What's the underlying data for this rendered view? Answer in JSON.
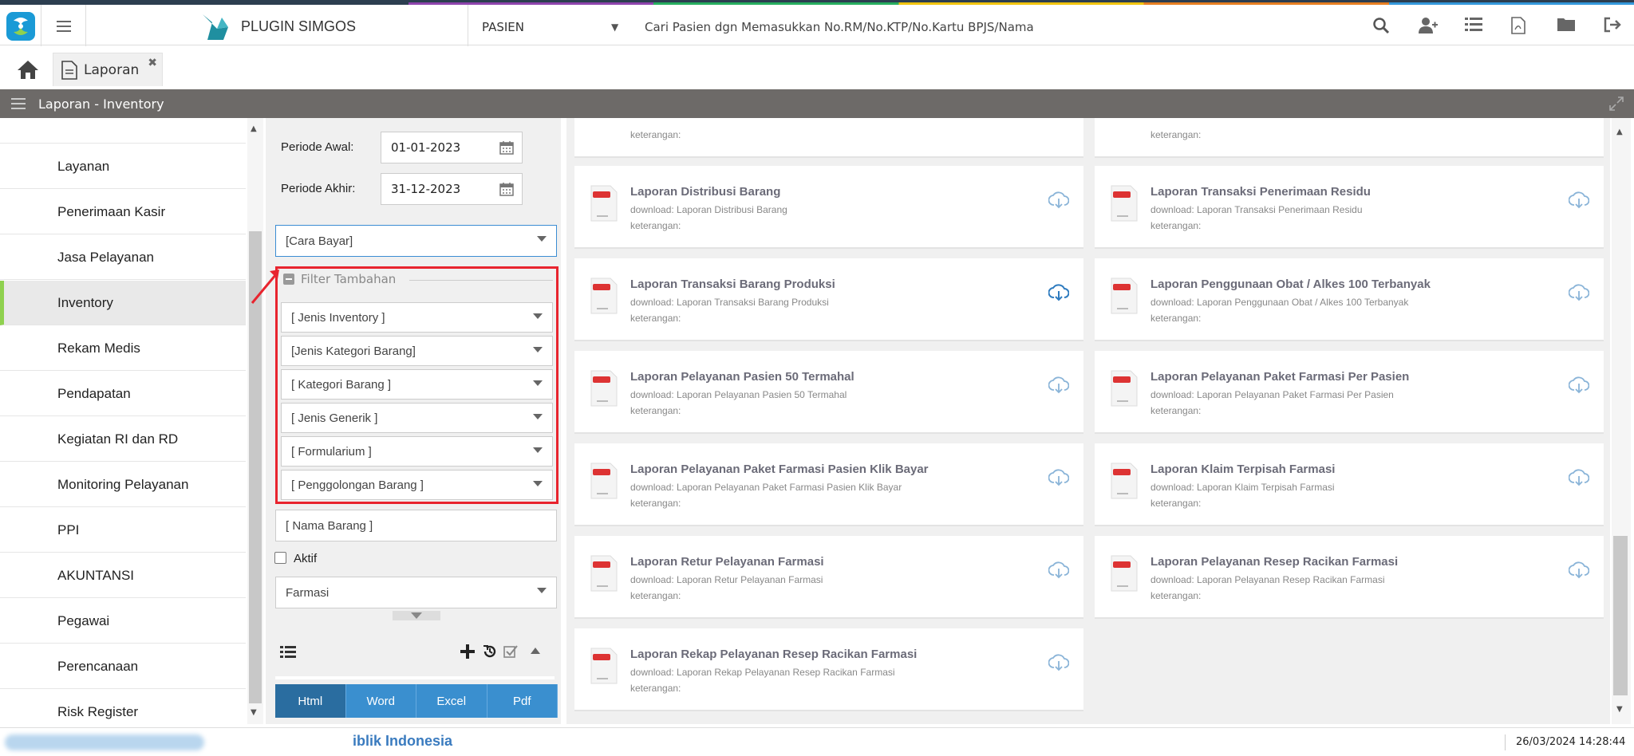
{
  "topbar": {
    "app_name": "PLUGIN SIMGOS",
    "patient_select": "PASIEN",
    "search_placeholder": "Cari Pasien dgn Memasukkan No.RM/No.KTP/No.Kartu BPJS/Nama",
    "icons": [
      "search-icon",
      "add-user-icon",
      "list-icon",
      "pdf-file-icon",
      "folder-icon",
      "logout-icon"
    ]
  },
  "tabs": [
    {
      "label": "Laporan"
    }
  ],
  "section": {
    "title": "Laporan - Inventory"
  },
  "sidebar": {
    "items": [
      {
        "label": "Layanan"
      },
      {
        "label": "Penerimaan Kasir"
      },
      {
        "label": "Jasa Pelayanan"
      },
      {
        "label": "Inventory",
        "active": true
      },
      {
        "label": "Rekam Medis"
      },
      {
        "label": "Pendapatan"
      },
      {
        "label": "Kegiatan RI dan RD"
      },
      {
        "label": "Monitoring Pelayanan"
      },
      {
        "label": "PPI"
      },
      {
        "label": "AKUNTANSI"
      },
      {
        "label": "Pegawai"
      },
      {
        "label": "Perencanaan"
      },
      {
        "label": "Risk Register"
      }
    ]
  },
  "filters": {
    "periode_awal_label": "Periode Awal:",
    "periode_awal_value": "01-01-2023",
    "periode_akhir_label": "Periode Akhir:",
    "periode_akhir_value": "31-12-2023",
    "cara_bayar": "[Cara Bayar]",
    "filter_tambahan": "Filter Tambahan",
    "extra": [
      "[ Jenis Inventory ]",
      "[Jenis Kategori Barang]",
      "[ Kategori Barang ]",
      "[ Jenis Generik ]",
      "[ Formularium ]",
      "[ Penggolongan Barang ]"
    ],
    "nama_barang": "[ Nama Barang ]",
    "aktif_label": "Aktif",
    "unit": "Farmasi"
  },
  "export_tabs": [
    "Html",
    "Word",
    "Excel",
    "Pdf"
  ],
  "reports": {
    "keterangan": "keterangan:",
    "items": [
      {
        "title": "Laporan Distribusi Barang",
        "download": "download: Laporan Distribusi Barang"
      },
      {
        "title": "Laporan Transaksi Penerimaan Residu",
        "download": "download: Laporan Transaksi Penerimaan Residu"
      },
      {
        "title": "Laporan Transaksi Barang Produksi",
        "download": "download: Laporan Transaksi Barang Produksi"
      },
      {
        "title": "Laporan Penggunaan Obat / Alkes 100 Terbanyak",
        "download": "download: Laporan Penggunaan Obat / Alkes 100 Terbanyak"
      },
      {
        "title": "Laporan Pelayanan Pasien 50 Termahal",
        "download": "download: Laporan Pelayanan Pasien 50 Termahal"
      },
      {
        "title": "Laporan Pelayanan Paket Farmasi Per Pasien",
        "download": "download: Laporan Pelayanan Paket Farmasi Per Pasien"
      },
      {
        "title": "Laporan Pelayanan Paket Farmasi Pasien Klik Bayar",
        "download": "download: Laporan Pelayanan Paket Farmasi Pasien Klik Bayar"
      },
      {
        "title": "Laporan Klaim Terpisah Farmasi",
        "download": "download: Laporan Klaim Terpisah Farmasi"
      },
      {
        "title": "Laporan Retur Pelayanan Farmasi",
        "download": "download: Laporan Retur Pelayanan Farmasi"
      },
      {
        "title": "Laporan Pelayanan Resep Racikan Farmasi",
        "download": "download: Laporan Pelayanan Resep Racikan Farmasi"
      },
      {
        "title": "Laporan Rekap Pelayanan Resep Racikan Farmasi",
        "download": "download: Laporan Rekap Pelayanan Resep Racikan Farmasi"
      }
    ]
  },
  "footer": {
    "org_text": "iblik Indonesia",
    "datetime": "26/03/2024 14:28:44"
  }
}
